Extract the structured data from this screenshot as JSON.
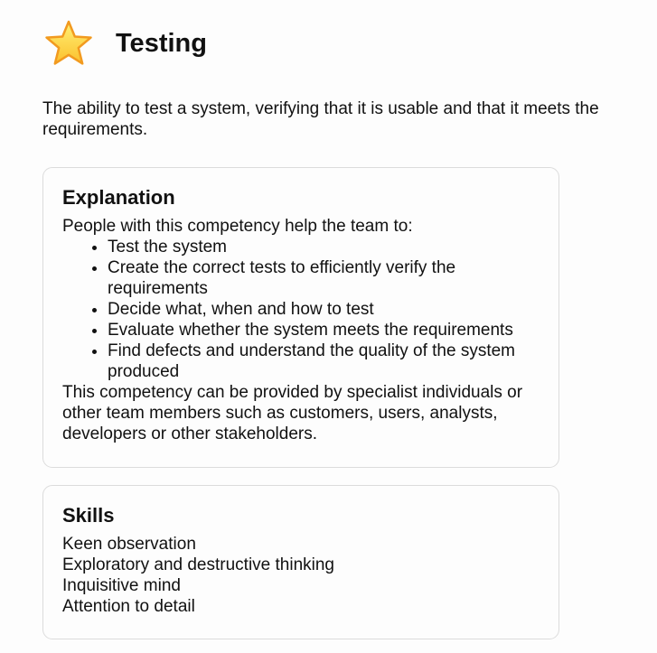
{
  "header": {
    "icon": "star-icon",
    "title": "Testing"
  },
  "description": "The ability to test a system, verifying that it is usable and that it meets the requirements.",
  "explanation": {
    "heading": "Explanation",
    "intro": "People with this competency help the team to:",
    "items": [
      "Test the system",
      "Create the correct tests to efficiently verify the requirements",
      "Decide what, when and how to test",
      "Evaluate whether the system meets the requirements",
      "Find defects and understand the quality of the system produced"
    ],
    "outro": "This competency can be provided by specialist individuals or other team members such as customers, users, analysts, developers or other stakeholders."
  },
  "skills": {
    "heading": "Skills",
    "items": [
      "Keen observation",
      "Exploratory and destructive thinking",
      "Inquisitive mind",
      "Attention to detail"
    ]
  },
  "colors": {
    "star_fill": "#fdd835",
    "star_stroke": "#f5a623",
    "card_border": "#dcdcdc"
  }
}
